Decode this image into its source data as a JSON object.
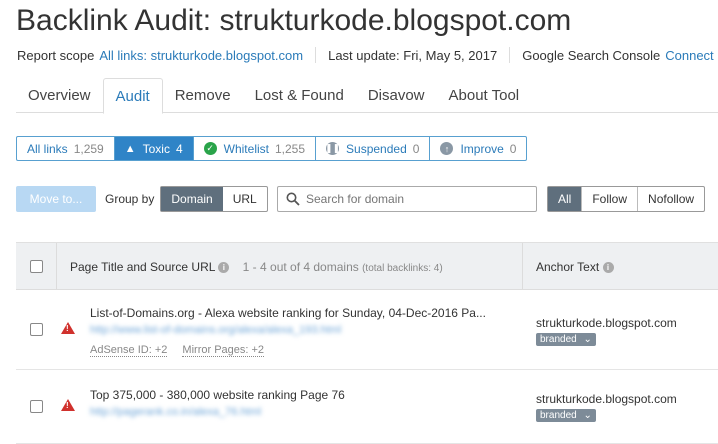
{
  "header": {
    "title": "Backlink Audit: strukturkode.blogspot.com",
    "report_scope_label": "Report scope",
    "report_scope_value": "All links: strukturkode.blogspot.com",
    "last_update": "Last update: Fri, May 5, 2017",
    "gsc_label": "Google Search Console",
    "gsc_link": "Connect"
  },
  "tabs": [
    "Overview",
    "Audit",
    "Remove",
    "Lost & Found",
    "Disavow",
    "About Tool"
  ],
  "filters": [
    {
      "label": "All links",
      "count": "1,259"
    },
    {
      "label": "Toxic",
      "count": "4"
    },
    {
      "label": "Whitelist",
      "count": "1,255"
    },
    {
      "label": "Suspended",
      "count": "0"
    },
    {
      "label": "Improve",
      "count": "0"
    }
  ],
  "toolbar": {
    "move_label": "Move to...",
    "group_by_label": "Group by",
    "group_options": [
      "Domain",
      "URL"
    ],
    "search_placeholder": "Search for domain",
    "follow_options": [
      "All",
      "Follow",
      "Nofollow"
    ]
  },
  "table": {
    "col_page_title": "Page Title and Source URL",
    "summary": "1 - 4 out of 4 domains",
    "summary_total": "(total backlinks: 4)",
    "col_anchor": "Anchor Text",
    "rows": [
      {
        "title": "List-of-Domains.org - Alexa website ranking for Sunday, 04-Dec-2016 Pa...",
        "url": "http://www.list-of-domains.org/alexa/alexa_193.html",
        "adsense": "AdSense ID: +2",
        "mirror": "Mirror Pages: +2",
        "anchor": "strukturkode.blogspot.com",
        "badge": "branded"
      },
      {
        "title": "Top 375,000 - 380,000 website ranking Page 76",
        "url": "http://pagerank.co.in/alexa_76.html",
        "anchor": "strukturkode.blogspot.com",
        "badge": "branded"
      }
    ]
  },
  "colors": {
    "accent": "#2b7bb9",
    "toxic": "#d0312d",
    "whitelist": "#2aa44a"
  }
}
